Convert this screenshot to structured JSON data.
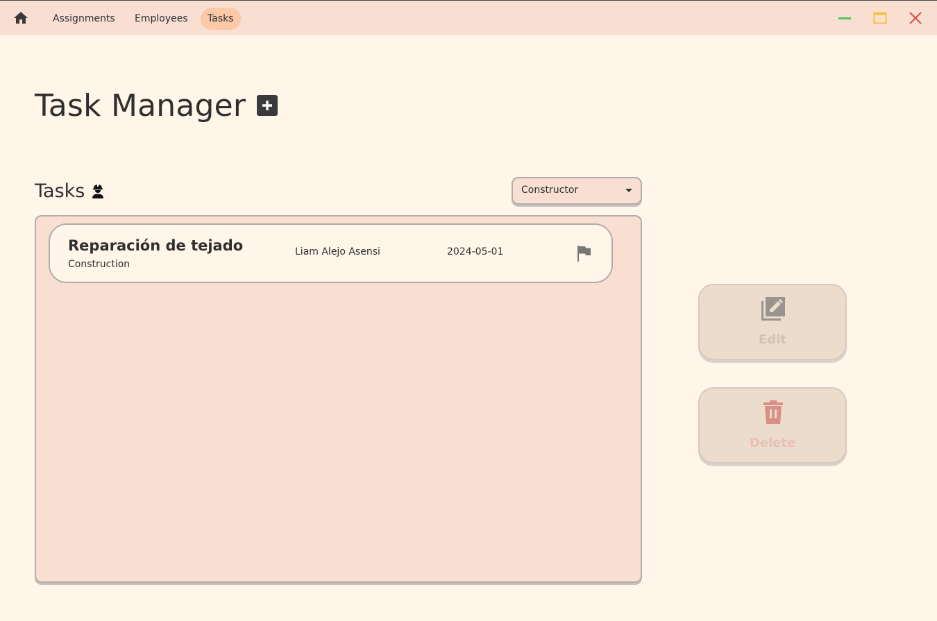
{
  "topbar": {
    "nav": [
      {
        "label": "Assignments",
        "active": false
      },
      {
        "label": "Employees",
        "active": false
      },
      {
        "label": "Tasks",
        "active": true
      }
    ],
    "icons": {
      "home": "home-icon",
      "minimize": "minimize-icon",
      "maximize": "maximize-icon",
      "close": "close-icon"
    },
    "colors": {
      "minimize": "#54c45a",
      "maximize": "#f5c33b",
      "close": "#d9534f",
      "active_tab": "#fbc8a8"
    }
  },
  "page": {
    "title": "Task Manager",
    "add_icon": "plus-square-icon"
  },
  "tasks_section": {
    "title": "Tasks",
    "icon": "construction-worker-icon",
    "filter": {
      "selected": "Constructor"
    },
    "items": [
      {
        "name": "Reparación de tejado",
        "category": "Construction",
        "assignee": "Liam Alejo Asensi",
        "date": "2024-05-01",
        "icon": "flag-icon"
      }
    ]
  },
  "actions": {
    "edit": {
      "label": "Edit",
      "icon": "edit-note-icon",
      "disabled": true
    },
    "delete": {
      "label": "Delete",
      "icon": "trash-icon",
      "disabled": true
    }
  }
}
